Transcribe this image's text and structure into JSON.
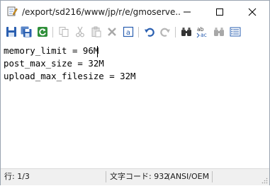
{
  "window": {
    "title": "/export/sd216/www/jp/r/e/gmoserve..."
  },
  "editor": {
    "lines": [
      "memory_limit = 96M",
      "post_max_size = 32M",
      "upload_max_filesize = 32M"
    ]
  },
  "status": {
    "line_info": "行: 1/3",
    "char_code": "文字コード: 932",
    "encoding": "(ANSI/OEM"
  },
  "colors": {
    "blue_icon": "#2a5fb0",
    "green_icon": "#2f8f3a",
    "disabled_icon": "#b5b5b5"
  }
}
